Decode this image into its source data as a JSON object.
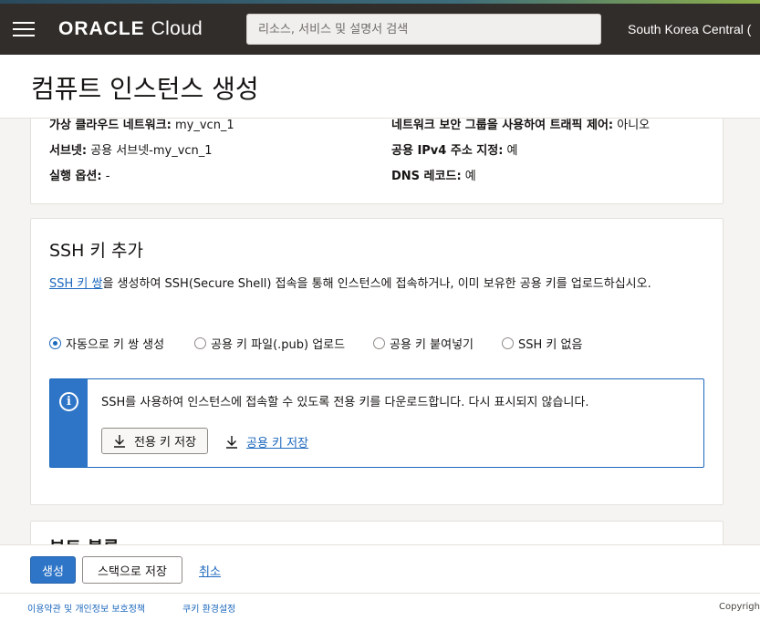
{
  "header": {
    "brand": "ORACLE",
    "product": "Cloud",
    "search_placeholder": "리소스, 서비스 및 설명서 검색",
    "region": "South Korea Central ("
  },
  "page": {
    "title": "컴퓨트 인스턴스 생성"
  },
  "networking": {
    "rows": [
      {
        "label": "가상 클라우드 네트워크:",
        "value": " my_vcn_1"
      },
      {
        "label": "네트워크 보안 그룹을 사용하여 트래픽 제어:",
        "value": " 아니오"
      },
      {
        "label": "서브넷:",
        "value": " 공용 서브넷-my_vcn_1"
      },
      {
        "label": "공용 IPv4 주소 지정:",
        "value": " 예"
      },
      {
        "label": "실행 옵션:",
        "value": " -"
      },
      {
        "label": "DNS 레코드:",
        "value": " 예"
      }
    ]
  },
  "ssh": {
    "title": "SSH 키 추가",
    "desc_link": "SSH 키 쌍",
    "desc_rest": "을 생성하여 SSH(Secure Shell) 접속을 통해 인스턴스에 접속하거나, 이미 보유한 공용 키를 업로드하십시오.",
    "options": [
      {
        "label": "자동으로 키 쌍 생성",
        "checked": true
      },
      {
        "label": "공용 키 파일(.pub) 업로드",
        "checked": false
      },
      {
        "label": "공용 키 붙여넣기",
        "checked": false
      },
      {
        "label": "SSH 키 없음",
        "checked": false
      }
    ],
    "info_icon": "i",
    "info_text": "SSH를 사용하여 인스턴스에 접속할 수 있도록 전용 키를 다운로드합니다. 다시 표시되지 않습니다.",
    "save_private_label": "전용 키 저장",
    "save_public_label": "공용 키 저장"
  },
  "boot": {
    "title": "부트 볼륨"
  },
  "actions": {
    "create_label": "생성",
    "save_stack_label": "스택으로 저장",
    "cancel_label": "취소"
  },
  "footer": {
    "terms": "이용약관 및 개인정보 보호정책",
    "cookies": "쿠키 환경설정",
    "copyright": "Copyrigh"
  },
  "colors": {
    "topbar": "#312d2a",
    "accent_blue": "#2f75c7",
    "link_blue": "#1c68bd",
    "content_bg": "#f5f4f2"
  },
  "icons": [
    "hamburger-menu-icon",
    "info-icon",
    "download-icon"
  ]
}
